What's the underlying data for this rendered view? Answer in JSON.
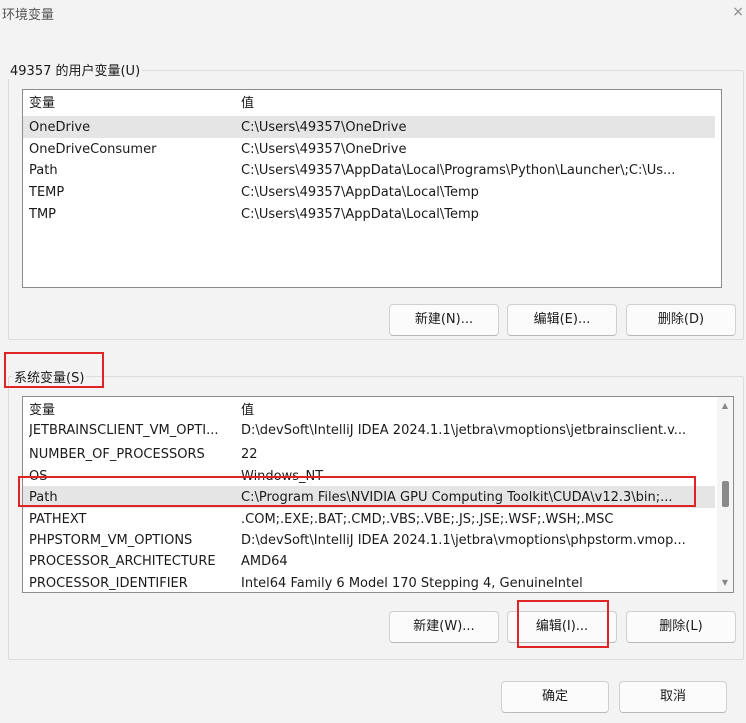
{
  "window": {
    "title": "环境变量",
    "close_glyph": "×"
  },
  "user_vars": {
    "group_label": "49357 的用户变量(U)",
    "columns": [
      "变量",
      "值"
    ],
    "rows": [
      {
        "name": "OneDrive",
        "value": "C:\\Users\\49357\\OneDrive"
      },
      {
        "name": "OneDriveConsumer",
        "value": "C:\\Users\\49357\\OneDrive"
      },
      {
        "name": "Path",
        "value": "C:\\Users\\49357\\AppData\\Local\\Programs\\Python\\Launcher\\;C:\\Us..."
      },
      {
        "name": "TEMP",
        "value": "C:\\Users\\49357\\AppData\\Local\\Temp"
      },
      {
        "name": "TMP",
        "value": "C:\\Users\\49357\\AppData\\Local\\Temp"
      }
    ],
    "selected_index": 0,
    "buttons": {
      "new": "新建(N)...",
      "edit": "编辑(E)...",
      "delete": "删除(D)"
    }
  },
  "system_vars": {
    "group_label": "系统变量(S)",
    "columns": [
      "变量",
      "值"
    ],
    "rows": [
      {
        "name": "JETBRAINSCLIENT_VM_OPTI...",
        "value": "D:\\devSoft\\IntelliJ IDEA 2024.1.1\\jetbra\\vmoptions\\jetbrainsclient.v..."
      },
      {
        "name": "NUMBER_OF_PROCESSORS",
        "value": "22"
      },
      {
        "name": "OS",
        "value": "Windows_NT"
      },
      {
        "name": "Path",
        "value": "C:\\Program Files\\NVIDIA GPU Computing Toolkit\\CUDA\\v12.3\\bin;..."
      },
      {
        "name": "PATHEXT",
        "value": ".COM;.EXE;.BAT;.CMD;.VBS;.VBE;.JS;.JSE;.WSF;.WSH;.MSC"
      },
      {
        "name": "PHPSTORM_VM_OPTIONS",
        "value": "D:\\devSoft\\IntelliJ IDEA 2024.1.1\\jetbra\\vmoptions\\phpstorm.vmop..."
      },
      {
        "name": "PROCESSOR_ARCHITECTURE",
        "value": "AMD64"
      },
      {
        "name": "PROCESSOR_IDENTIFIER",
        "value": "Intel64 Family 6 Model 170 Stepping 4, GenuineIntel"
      }
    ],
    "selected_index": 3,
    "buttons": {
      "new": "新建(W)...",
      "edit": "编辑(I)...",
      "delete": "删除(L)"
    }
  },
  "footer": {
    "ok": "确定",
    "cancel": "取消"
  },
  "colors": {
    "highlight": "#e02424",
    "selection": "#e5e5e5"
  }
}
